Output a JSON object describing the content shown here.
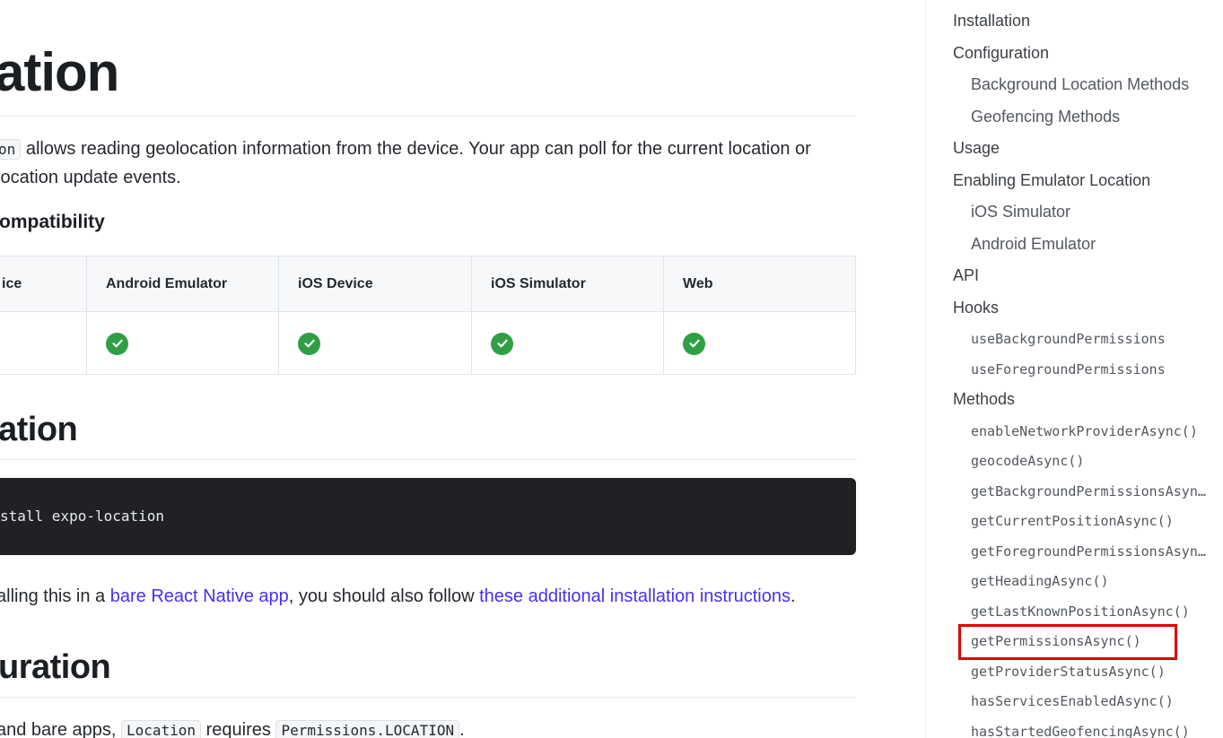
{
  "main": {
    "title": "ation",
    "intro": {
      "code_chip": "on",
      "text_line1": " allows reading geolocation information from the device. Your app can poll for the current location or",
      "text_line2": " location update events."
    },
    "compat_heading": "ompatibility",
    "compat_table": {
      "headers": [
        "ice",
        "Android Emulator",
        "iOS Device",
        "iOS Simulator",
        "Web"
      ],
      "supported": [
        false,
        true,
        true,
        true,
        true
      ]
    },
    "installation_heading": "ation",
    "install_command": "stall expo-location",
    "bare_note": {
      "prefix": "alling this in a ",
      "link1": "bare React Native app",
      "middle": ", you should also follow ",
      "link2": "these additional installation instructions",
      "suffix": "."
    },
    "configuration_heading": "uration",
    "config_note": {
      "prefix": "and bare apps, ",
      "code1": "Location",
      "middle": " requires ",
      "code2": "Permissions.LOCATION",
      "suffix": "."
    }
  },
  "sidebar": {
    "items": [
      {
        "label": "Installation",
        "level": 1
      },
      {
        "label": "Configuration",
        "level": 1
      },
      {
        "label": "Background Location Methods",
        "level": 2
      },
      {
        "label": "Geofencing Methods",
        "level": 2
      },
      {
        "label": "Usage",
        "level": 1
      },
      {
        "label": "Enabling Emulator Location",
        "level": 1
      },
      {
        "label": "iOS Simulator",
        "level": 2
      },
      {
        "label": "Android Emulator",
        "level": 2
      },
      {
        "label": "API",
        "level": 1
      },
      {
        "label": "Hooks",
        "level": 1
      },
      {
        "label": "useBackgroundPermissions",
        "level": 3
      },
      {
        "label": "useForegroundPermissions",
        "level": 3
      },
      {
        "label": "Methods",
        "level": 1
      },
      {
        "label": "enableNetworkProviderAsync()",
        "level": 3
      },
      {
        "label": "geocodeAsync()",
        "level": 3
      },
      {
        "label": "getBackgroundPermissionsAsync()",
        "level": 3
      },
      {
        "label": "getCurrentPositionAsync()",
        "level": 3
      },
      {
        "label": "getForegroundPermissionsAsync()",
        "level": 3
      },
      {
        "label": "getHeadingAsync()",
        "level": 3
      },
      {
        "label": "getLastKnownPositionAsync()",
        "level": 3
      },
      {
        "label": "getPermissionsAsync()",
        "level": 3
      },
      {
        "label": "getProviderStatusAsync()",
        "level": 3
      },
      {
        "label": "hasServicesEnabledAsync()",
        "level": 3
      },
      {
        "label": "hasStartedGeofencingAsync()",
        "level": 3
      }
    ],
    "highlighted_item": "getPermissionsAsync()",
    "highlight_color": "#e00000"
  },
  "colors": {
    "link": "#4630eb",
    "check": "#2ea043",
    "code_bg": "#1f2125"
  }
}
